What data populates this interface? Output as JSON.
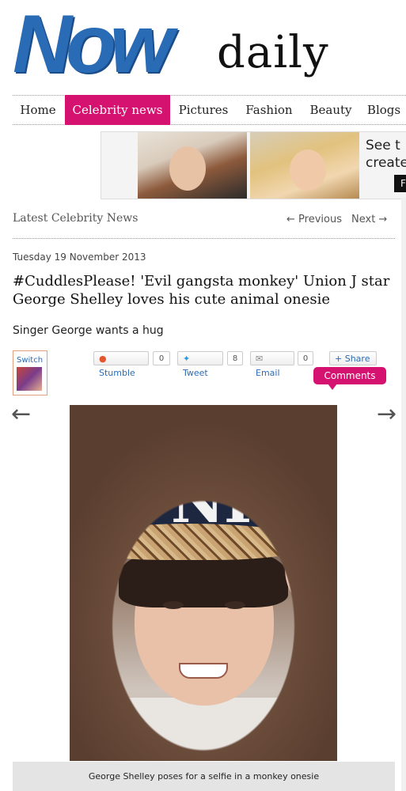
{
  "logo": {
    "brand": "Now",
    "sub": "daily"
  },
  "nav": {
    "items": [
      {
        "label": "Home"
      },
      {
        "label": "Celebrity news"
      },
      {
        "label": "Pictures"
      },
      {
        "label": "Fashion"
      },
      {
        "label": "Beauty"
      },
      {
        "label": "Blogs"
      }
    ]
  },
  "ad": {
    "text_line1": "See t",
    "text_line2": "create",
    "button": "F"
  },
  "section": {
    "title": "Latest Celebrity News",
    "prev": "← Previous",
    "next": "Next →"
  },
  "article": {
    "date": "Tuesday 19 November 2013",
    "headline": "#CuddlesPlease! 'Evil gangsta monkey' Union J star George Shelley loves his cute animal onesie",
    "standfirst": "Singer George wants a hug",
    "caption": "George Shelley poses for a selfie in a monkey onesie"
  },
  "switch": {
    "label": "Switch"
  },
  "share": {
    "stumble": {
      "label": "Stumble",
      "count": "0"
    },
    "tweet": {
      "label": "Tweet",
      "count": "8"
    },
    "email": {
      "label": "Email",
      "count": "0"
    },
    "share": {
      "label": "+ Share"
    }
  },
  "comments": {
    "label": "Comments"
  },
  "gallery": {
    "prev_arrow": "←",
    "next_arrow": "→"
  },
  "colors": {
    "brand_blue": "#2a6bb5",
    "accent_pink": "#d5126f"
  }
}
